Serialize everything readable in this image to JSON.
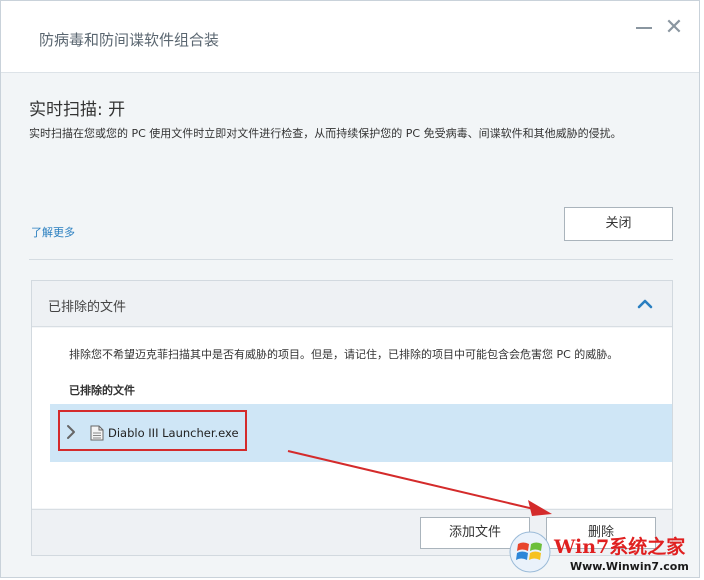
{
  "window": {
    "title": "防病毒和防间谍软件组合装",
    "minimize_label": "—",
    "close_glyph": "✕"
  },
  "realtime": {
    "title": "实时扫描: 开",
    "description": "实时扫描在您或您的 PC 使用文件时立即对文件进行检查，从而持续保护您的 PC 免受病毒、间谍软件和其他威胁的侵扰。",
    "learn_more": "了解更多",
    "close_label": "关闭"
  },
  "excluded": {
    "panel_title": "已排除的文件",
    "description": "排除您不希望迈克菲扫描其中是否有威胁的项目。但是，请记住，已排除的项目中可能包含会危害您 PC 的威胁。",
    "files_label": "已排除的文件",
    "files": [
      {
        "name": "Diablo III Launcher.exe"
      }
    ],
    "add_label": "添加文件",
    "remove_label": "删除"
  },
  "watermark": {
    "title": "Win7系统之家",
    "url": "Www.Winwin7.com"
  },
  "colors": {
    "accent": "#2a7fc0",
    "selected_row": "#cfe6f6",
    "annotation_red": "#d42b2b",
    "watermark_red": "#e02020"
  },
  "icons": {
    "panel_toggle": "chevron-up-icon",
    "row_expand": "chevron-right-icon",
    "file": "file-icon"
  }
}
